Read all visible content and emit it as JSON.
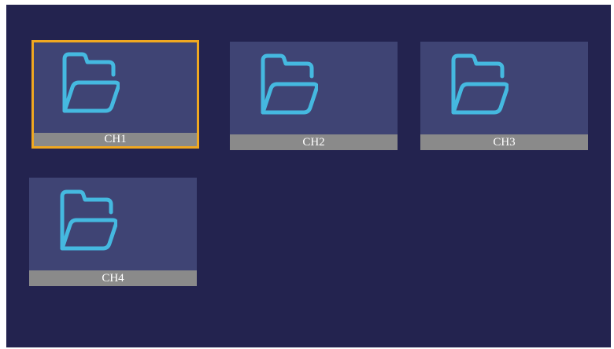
{
  "channels": [
    {
      "label": "CH1",
      "icon": "folder-icon",
      "selected": true
    },
    {
      "label": "CH2",
      "icon": "folder-icon",
      "selected": false
    },
    {
      "label": "CH3",
      "icon": "folder-icon",
      "selected": false
    },
    {
      "label": "CH4",
      "icon": "folder-icon",
      "selected": false
    }
  ],
  "colors": {
    "background": "#23234f",
    "tile": "#3f4474",
    "label_bar": "#8a8a8a",
    "selection": "#f0a820",
    "icon": "#45b9e0"
  }
}
